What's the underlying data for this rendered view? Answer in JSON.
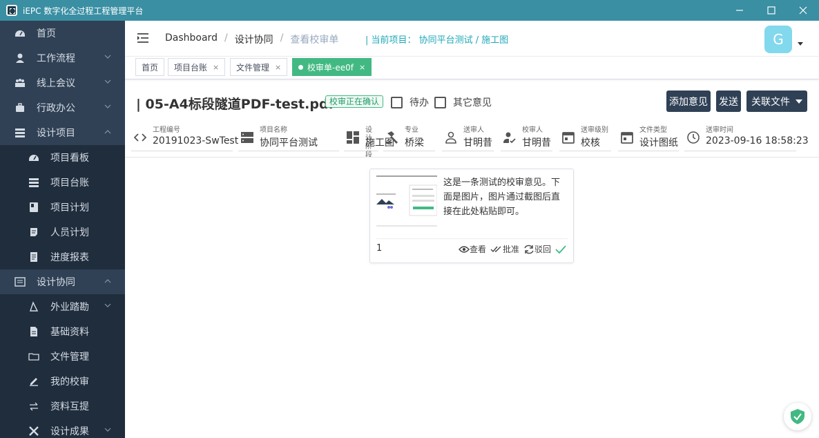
{
  "window": {
    "title": "iEPC 数字化全过程工程管理平台"
  },
  "sidebar": {
    "items": [
      {
        "label": "首页",
        "icon": "dashboard-icon"
      },
      {
        "label": "工作流程",
        "icon": "user-icon"
      },
      {
        "label": "线上会议",
        "icon": "meeting-icon"
      },
      {
        "label": "行政办公",
        "icon": "briefcase-icon"
      },
      {
        "label": "设计项目",
        "icon": "list-icon"
      },
      {
        "label": "项目看板",
        "icon": "dashboard-icon"
      },
      {
        "label": "项目台账",
        "icon": "list-icon"
      },
      {
        "label": "项目计划",
        "icon": "book-icon"
      },
      {
        "label": "人员计划",
        "icon": "note-icon"
      },
      {
        "label": "进度报表",
        "icon": "report-icon"
      },
      {
        "label": "设计协同",
        "icon": "collab-icon"
      },
      {
        "label": "外业踏勘",
        "icon": "survey-icon"
      },
      {
        "label": "基础资料",
        "icon": "file-icon"
      },
      {
        "label": "文件管理",
        "icon": "folder-icon"
      },
      {
        "label": "我的校审",
        "icon": "sign-icon"
      },
      {
        "label": "资料互提",
        "icon": "exchange-icon"
      },
      {
        "label": "设计成果",
        "icon": "tools-icon"
      }
    ]
  },
  "breadcrumb": {
    "items": [
      "Dashboard",
      "设计协同",
      "查看校审单"
    ]
  },
  "current_project": "| 当前项目： 协同平台测试 / 施工图",
  "avatar": {
    "letter": "G"
  },
  "tags": [
    {
      "label": "首页"
    },
    {
      "label": "项目台账",
      "close": "×"
    },
    {
      "label": "文件管理",
      "close": "×"
    },
    {
      "label": "校审单-ee0f",
      "close": "×"
    }
  ],
  "document": {
    "title": "| 05-A4标段隧道PDF-test.pdf",
    "status": "校审正在确认",
    "checkbox_todo": "待办",
    "checkbox_other": "其它意见"
  },
  "buttons": {
    "add_opinion": "添加意见",
    "send": "发送",
    "related_files": "关联文件"
  },
  "fields": [
    {
      "label": "工程编号",
      "value": "20191023-SwTest",
      "icon": "code-icon"
    },
    {
      "label": "项目名称",
      "value": "协同平台测试",
      "icon": "server-icon"
    },
    {
      "label": "设计阶段",
      "value": "施工图",
      "icon": "dashboard-grid-icon"
    },
    {
      "label": "专业",
      "value": "桥梁",
      "icon": "hammer-icon"
    },
    {
      "label": "送审人",
      "value": "甘明昔",
      "icon": "person-icon"
    },
    {
      "label": "校审人",
      "value": "甘明昔",
      "icon": "person-check-icon"
    },
    {
      "label": "送审级别",
      "value": "校核",
      "icon": "calendar-icon"
    },
    {
      "label": "文件类型",
      "value": "设计图纸",
      "icon": "calendar-icon"
    },
    {
      "label": "送审时间",
      "value": "2023-09-16 18:58:23",
      "icon": "clock-icon"
    }
  ],
  "comment": {
    "text": "这是一条测试的校审意见。下面是图片，图片通过截图后直接在此处粘贴即可。",
    "number": "1",
    "actions": {
      "view": "查看",
      "approve": "批准",
      "reject": "驳回"
    }
  },
  "colors": {
    "sidebar_bg": "#304156",
    "titlebar_bg": "#3a8fa3",
    "accent": "#42b983",
    "button_bg": "#304156"
  }
}
